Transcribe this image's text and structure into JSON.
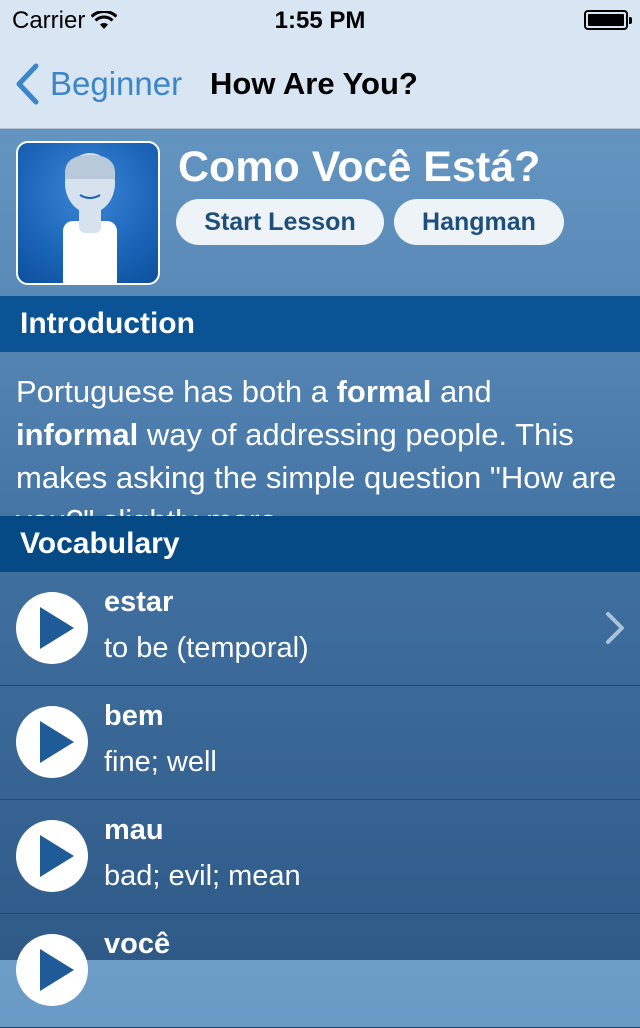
{
  "status_bar": {
    "carrier": "Carrier",
    "time": "1:55 PM",
    "battery_level": 1.0
  },
  "nav": {
    "back_label": "Beginner",
    "title": "How Are You?"
  },
  "lesson": {
    "title": "Como Você Está?",
    "start_button": "Start Lesson",
    "hangman_button": "Hangman"
  },
  "sections": {
    "introduction": "Introduction",
    "vocabulary": "Vocabulary"
  },
  "intro": {
    "p1": "Portuguese has both a ",
    "b1": "formal",
    "p2": " and ",
    "b2": "informal",
    "p3": " way of addressing people. This makes asking the simple question \"How are you?\" slightly more"
  },
  "vocab": [
    {
      "word": "estar",
      "meaning": "to be (temporal)"
    },
    {
      "word": "bem",
      "meaning": "fine; well"
    },
    {
      "word": "mau",
      "meaning": "bad; evil; mean"
    },
    {
      "word": "você",
      "meaning": ""
    }
  ],
  "colors": {
    "accent": "#3c85c6",
    "section_header": "#0a5394",
    "pill_text": "#1d4f7d"
  }
}
